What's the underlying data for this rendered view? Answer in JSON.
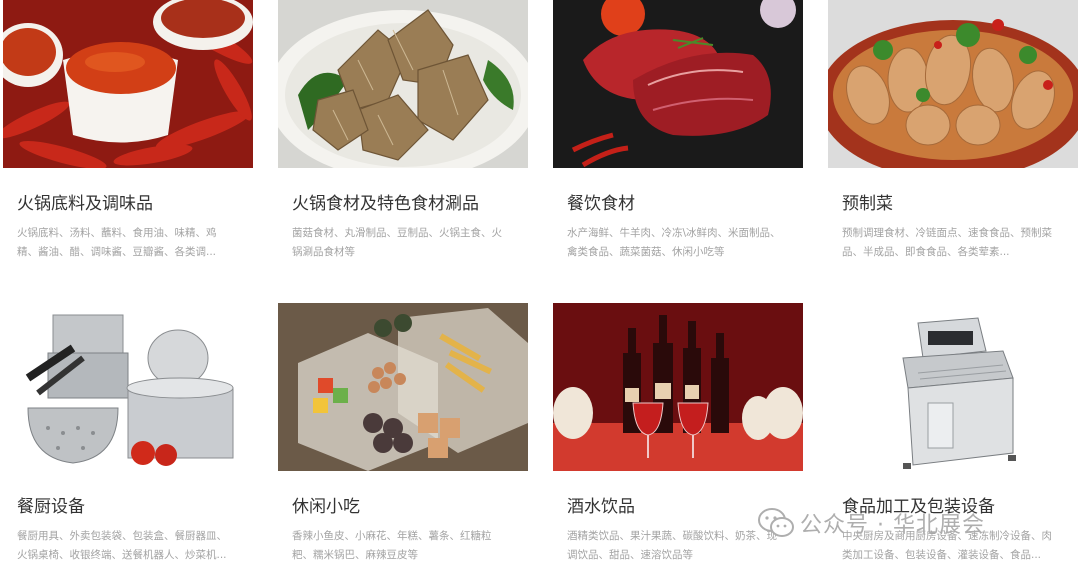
{
  "cards": [
    {
      "title": "火锅底料及调味品",
      "desc": "火锅底料、汤料、蘸料、食用油、味精、鸡精、酱油、醋、调味酱、豆瓣酱、各类调...",
      "image": "chili-spice-bowls"
    },
    {
      "title": "火锅食材及特色食材涮品",
      "desc": "菌菇食材、丸滑制品、豆制品、火锅主食、火锅涮品食材等",
      "image": "tripe-dish"
    },
    {
      "title": "餐饮食材",
      "desc": "水产海鲜、牛羊肉、冷冻\\冰鲜肉、米面制品、禽类食品、蔬菜菌菇、休闲小吃等",
      "image": "raw-beef"
    },
    {
      "title": "预制菜",
      "desc": "预制调理食材、冷链面点、速食食品、预制菜品、半成品、即食食品、各类荤素...",
      "image": "spicy-shrimp-plate"
    },
    {
      "title": "餐厨设备",
      "desc": "餐厨用具、外卖包装袋、包装盒、餐厨器皿、火锅桌椅、收银终端、送餐机器人、炒菜机...",
      "image": "cookware-pots"
    },
    {
      "title": "休闲小吃",
      "desc": "香辣小鱼皮、小麻花、年糕、薯条、红糖粒粑、糯米锅巴、麻辣豆皮等",
      "image": "snack-tray"
    },
    {
      "title": "酒水饮品",
      "desc": "酒精类饮品、果汁果蔬、碳酸饮料、奶茶、现调饮品、甜品、速溶饮品等",
      "image": "wine-bottles"
    },
    {
      "title": "食品加工及包装设备",
      "desc": "中央厨房及商用厨房设备、速冻制冷设备、肉类加工设备、包装设备、灌装设备、食品...",
      "image": "food-processing-machine"
    }
  ],
  "watermark": {
    "text": "公众号 · 华北展会",
    "icon": "wechat-icon"
  }
}
